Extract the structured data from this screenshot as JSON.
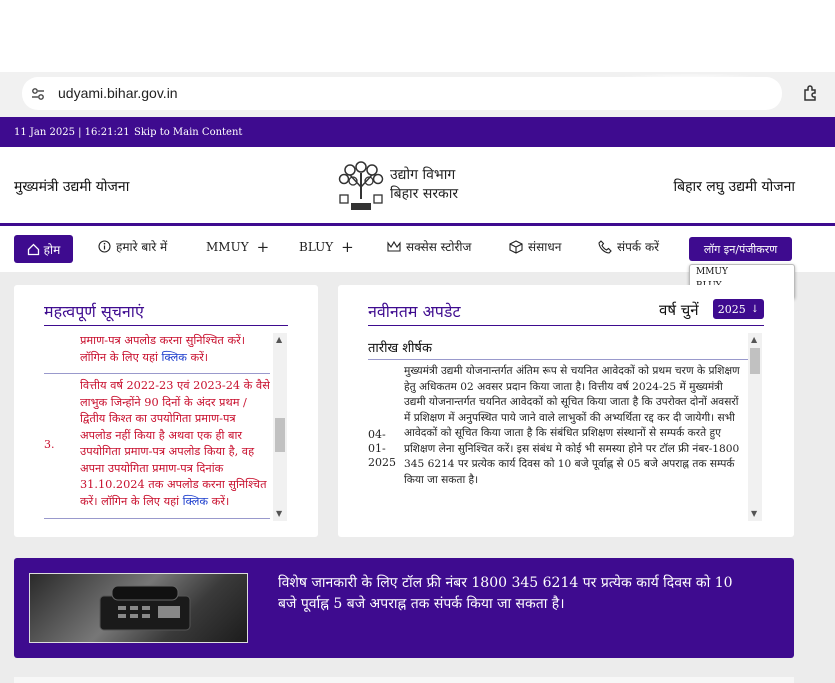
{
  "browser": {
    "url": "udyami.bihar.gov.in"
  },
  "topbar": {
    "datetime": "11 Jan 2025 | 16:21:21",
    "skip_link": "Skip to Main Content"
  },
  "header": {
    "left_title": "मुख्यमंत्री उद्यमी योजना",
    "dept_line1": "उद्योग विभाग",
    "dept_line2": "बिहार सरकार",
    "right_title": "बिहार लघु उद्यमी योजना"
  },
  "nav": {
    "home": "होम",
    "about": "हमारे बारे में",
    "mmuy": "MMUY",
    "bluy": "BLUY",
    "success": "सक्सेस स्टोरीज",
    "resources": "संसाधन",
    "contact": "संपर्क करें",
    "login": "लॉग इन/पंजीकरण",
    "login_dropdown": [
      "MMUY",
      "BLUY"
    ]
  },
  "notices": {
    "title": "महत्वपूर्ण सूचनाएं",
    "prev_item_tail_1": "प्रमाण-पत्र अपलोड करना सुनिश्चित करें।",
    "prev_item_tail_2a": "लॉगिन के लिए यहां ",
    "prev_item_tail_link": "क्लिक",
    "prev_item_tail_2b": " करें।",
    "item3_num": "3.",
    "item3_text": "वित्तीय वर्ष 2022-23 एवं 2023-24 के वैसे लाभुक जिन्होंने 90 दिनों के अंदर प्रथम / द्वितीय किश्त का उपयोगिता प्रमाण-पत्र अपलोड नहीं किया है अथवा एक ही बार उपयोगिता प्रमाण-पत्र अपलोड किया है, वह अपना उपयोगिता प्रमाण-पत्र दिनांक 31.10.2024 तक अपलोड करना सुनिश्चित करें। लॉगिन के लिए यहां ",
    "item3_link": "क्लिक",
    "item3_end": " करें।"
  },
  "updates": {
    "title": "नवीनतम अपडेट",
    "year_label": "वर्ष चुनें",
    "year_value": "2025",
    "col_head": "तारीख शीर्षक",
    "date": "04-01-2025",
    "text": "मुख्यमंत्री उद्यमी योजनान्तर्गत अंतिम रूप से चयनित आवेदकों को प्रथम चरण के प्रशिक्षण हेतु अधिकतम 02 अवसर प्रदान किया जाता है। वित्तीय वर्ष 2024-25 में मुख्यमंत्री उद्यमी योजनान्तर्गत चयनित आवेदकों को सूचित किया जाता है कि उपरोक्त दोनों अवसरों में प्रशिक्षण में अनुपस्थित पाये जाने वाले लाभुकों की अभ्यर्थिता रद्द कर दी जायेगी। सभी आवेदकों को सूचित किया जाता है कि संबंधित प्रशिक्षण संस्थानों से सम्पर्क करते हुए प्रशिक्षण लेना सुनिश्चित करें। इस संबंध मे कोई भी समस्या होने पर टॉल फ्री नंबर-1800 345 6214 पर प्रत्येक कार्य दिवस को 10 बजे पूर्वाह्न से 05 बजे अपराह्न तक सम्पर्क किया जा सकता है।"
  },
  "banner": {
    "text": "विशेष जानकारी के लिए टॉल फ्री नंबर 1800 345 6214 पर प्रत्येक कार्य दिवस को 10 बजे पूर्वाह्न 5 बजे अपराह्न तक संपर्क किया जा सकता है।"
  },
  "colors": {
    "primary": "#3e0b8f",
    "notice_red": "#c8102e",
    "link_blue": "#1a3bcc"
  }
}
